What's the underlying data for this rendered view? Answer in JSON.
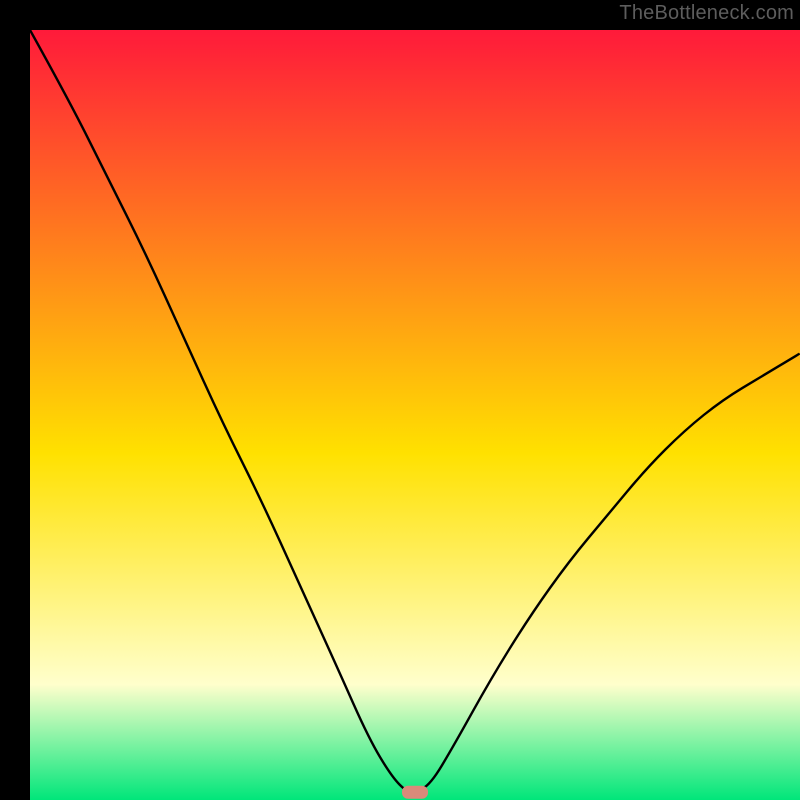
{
  "watermark": "TheBottleneck.com",
  "chart_data": {
    "type": "line",
    "title": "",
    "xlabel": "",
    "ylabel": "",
    "xlim": [
      0,
      100
    ],
    "ylim": [
      0,
      100
    ],
    "grid": false,
    "legend": "none",
    "background_gradient": {
      "top_color": "#ff1a3a",
      "mid_color": "#ffe100",
      "lower_color": "#ffffcc",
      "bottom_color": "#00e67a",
      "stops_pct": [
        0,
        55,
        85,
        100
      ]
    },
    "marker": {
      "x": 50,
      "y": 1,
      "color": "#d98a7a",
      "shape": "rounded-rect"
    },
    "series": [
      {
        "name": "bottleneck-curve",
        "x": [
          0,
          5,
          10,
          15,
          20,
          25,
          30,
          35,
          40,
          44,
          47,
          49,
          50,
          52,
          55,
          60,
          65,
          70,
          75,
          80,
          85,
          90,
          95,
          100
        ],
        "values": [
          100,
          91,
          81,
          71,
          60,
          49,
          39,
          28,
          17,
          8,
          3,
          1,
          1,
          2,
          7,
          16,
          24,
          31,
          37,
          43,
          48,
          52,
          55,
          58
        ]
      }
    ]
  }
}
